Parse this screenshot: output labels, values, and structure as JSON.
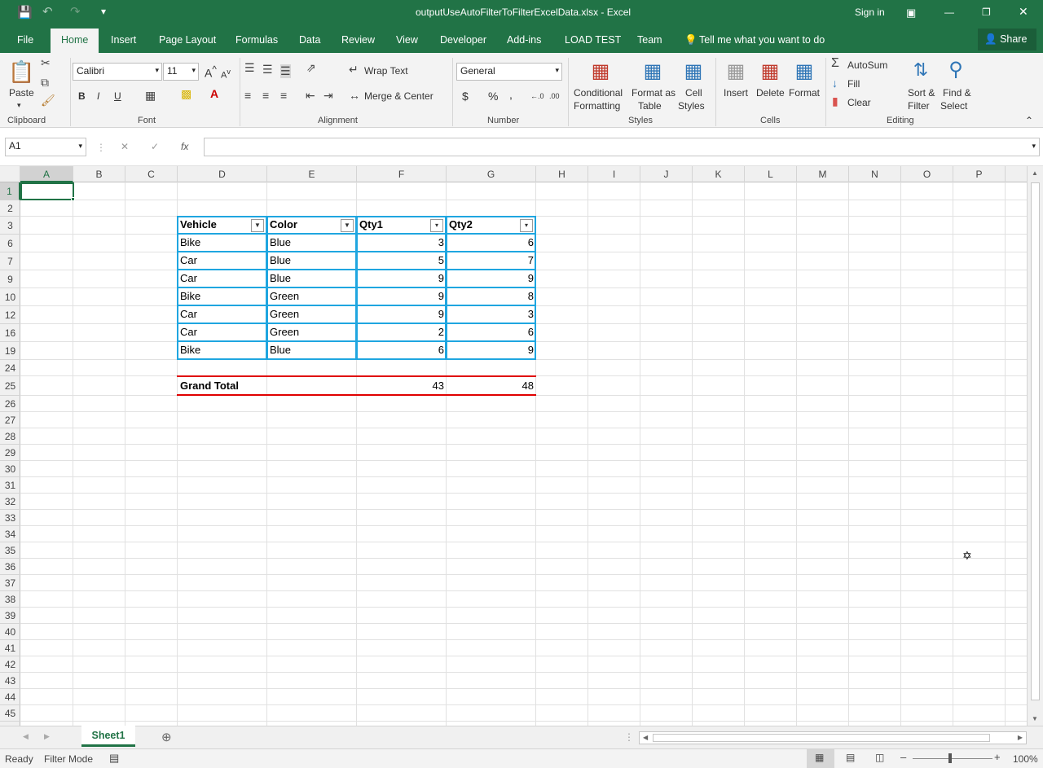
{
  "window": {
    "title": "outputUseAutoFilterToFilterExcelData.xlsx - Excel",
    "sign_in": "Sign in"
  },
  "tabs": [
    "File",
    "Home",
    "Insert",
    "Page Layout",
    "Formulas",
    "Data",
    "Review",
    "View",
    "Developer",
    "Add-ins",
    "LOAD TEST",
    "Team"
  ],
  "tell_me": "Tell me what you want to do",
  "share": "Share",
  "ribbon": {
    "clipboard": {
      "paste": "Paste",
      "label": "Clipboard"
    },
    "font": {
      "name": "Calibri",
      "size": "11",
      "label": "Font",
      "bold": "B",
      "italic": "I",
      "underline": "U"
    },
    "alignment": {
      "wrap": "Wrap Text",
      "merge": "Merge & Center",
      "label": "Alignment"
    },
    "number": {
      "format": "General",
      "label": "Number",
      "currency": "$",
      "percent": "%",
      "comma": ","
    },
    "styles": {
      "conditional": "Conditional",
      "conditional2": "Formatting",
      "format_table": "Format as",
      "format_table2": "Table",
      "cell_styles": "Cell",
      "cell_styles2": "Styles",
      "label": "Styles"
    },
    "cells": {
      "insert": "Insert",
      "delete": "Delete",
      "format": "Format",
      "label": "Cells"
    },
    "editing": {
      "autosum": "AutoSum",
      "fill": "Fill",
      "clear": "Clear",
      "sort": "Sort &",
      "sort2": "Filter",
      "find": "Find &",
      "find2": "Select",
      "label": "Editing"
    }
  },
  "formula_bar": {
    "name_box": "A1",
    "fx": "fx",
    "formula": ""
  },
  "columns": [
    "A",
    "B",
    "C",
    "D",
    "E",
    "F",
    "G",
    "H",
    "I",
    "J",
    "K",
    "L",
    "M",
    "N",
    "O",
    "P"
  ],
  "rows": [
    "1",
    "2",
    "3",
    "6",
    "7",
    "9",
    "10",
    "12",
    "16",
    "19",
    "24",
    "25",
    "26",
    "27",
    "28",
    "29",
    "30",
    "31",
    "32",
    "33",
    "34",
    "35",
    "36",
    "37",
    "38",
    "39",
    "40",
    "41",
    "42",
    "43",
    "44",
    "45"
  ],
  "table": {
    "headers": [
      "Vehicle",
      "Color",
      "Qty1",
      "Qty2"
    ],
    "rows": [
      [
        "Bike",
        "Blue",
        "3",
        "6"
      ],
      [
        "Car",
        "Blue",
        "5",
        "7"
      ],
      [
        "Car",
        "Blue",
        "9",
        "9"
      ],
      [
        "Bike",
        "Green",
        "9",
        "8"
      ],
      [
        "Car",
        "Green",
        "9",
        "3"
      ],
      [
        "Car",
        "Green",
        "2",
        "6"
      ],
      [
        "Bike",
        "Blue",
        "6",
        "9"
      ]
    ],
    "total_label": "Grand Total",
    "total_qty1": "43",
    "total_qty2": "48"
  },
  "sheet_tab": "Sheet1",
  "status": {
    "ready": "Ready",
    "mode": "Filter Mode",
    "zoom": "100%"
  }
}
